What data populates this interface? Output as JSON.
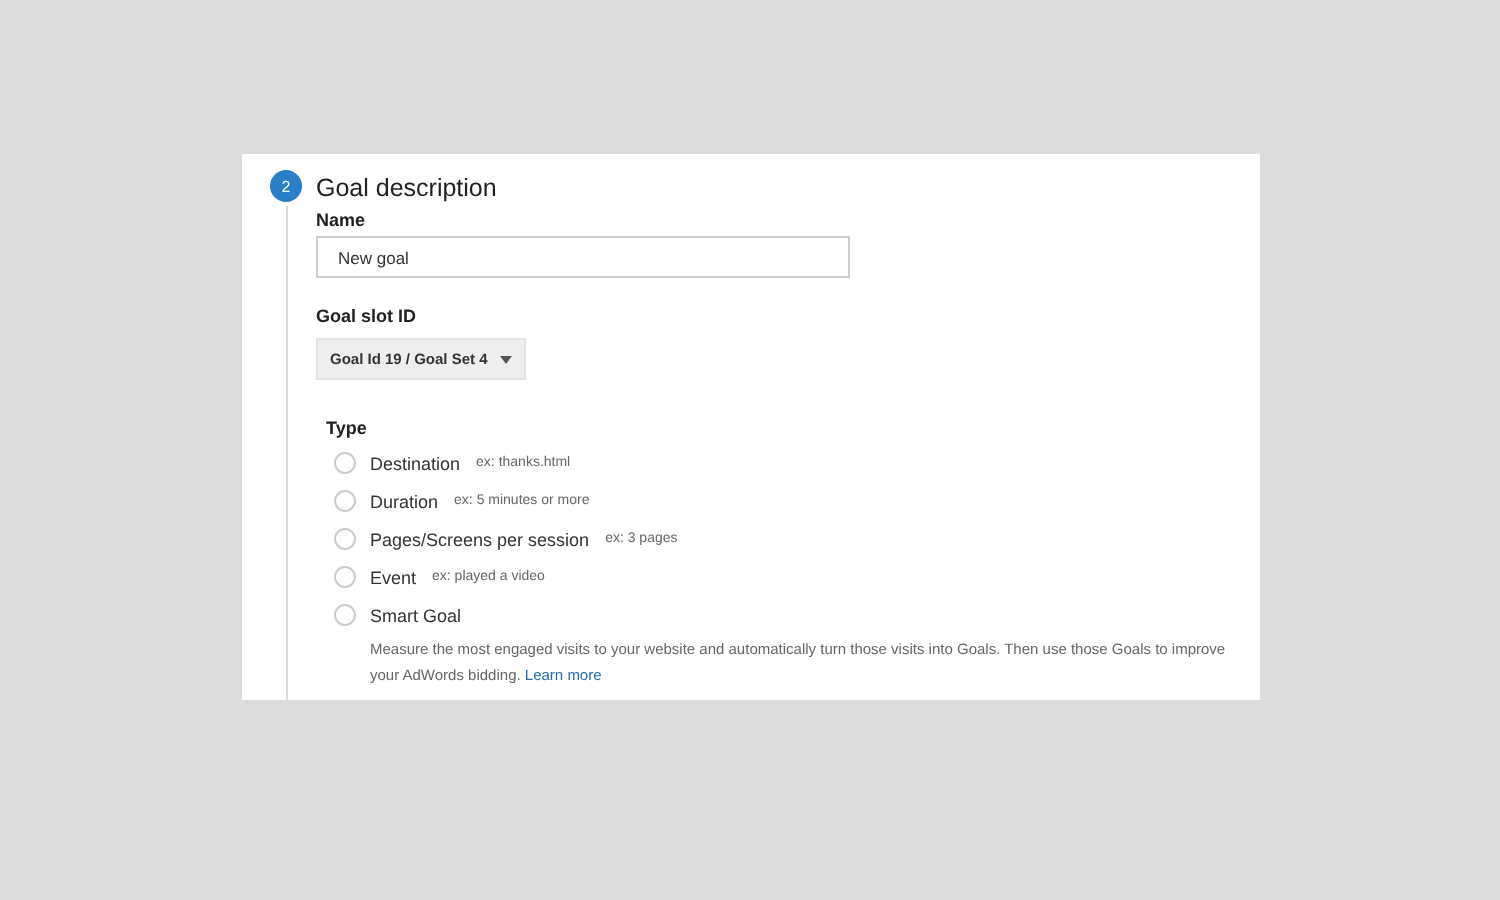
{
  "step": {
    "number": "2",
    "title": "Goal description"
  },
  "name_field": {
    "label": "Name",
    "value": "New goal"
  },
  "slot_field": {
    "label": "Goal slot ID",
    "value": "Goal Id 19 / Goal Set 4"
  },
  "type": {
    "label": "Type",
    "options": [
      {
        "label": "Destination",
        "hint": "ex: thanks.html",
        "selected": false
      },
      {
        "label": "Duration",
        "hint": "ex: 5 minutes or more",
        "selected": false
      },
      {
        "label": "Pages/Screens per session",
        "hint": "ex: 3 pages",
        "selected": false
      },
      {
        "label": "Event",
        "hint": "ex: played a video",
        "selected": false
      },
      {
        "label": "Smart Goal",
        "selected": false,
        "description": "Measure the most engaged visits to your website and automatically turn those visits into Goals. Then use those Goals to improve your AdWords bidding.",
        "link": "Learn more"
      }
    ]
  }
}
